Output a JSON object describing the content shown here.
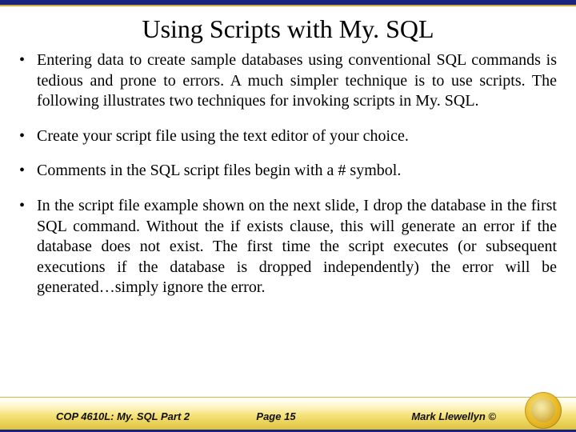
{
  "title": "Using Scripts with My. SQL",
  "bullets": [
    "Entering data to create sample databases using conventional SQL commands is tedious and prone to errors.  A much simpler technique is to use scripts.  The following illustrates two techniques for invoking scripts in My. SQL.",
    "Create your script file using the text editor of your choice.",
    "Comments in the SQL script files begin with a  # symbol.",
    "In the script file example shown on the next slide, I drop the database in the first SQL command.  Without the if exists clause, this will generate an error if the database does not exist.  The first time the script executes (or subsequent executions if the database is dropped independently) the error will be generated…simply ignore the error."
  ],
  "footer": {
    "left": "COP 4610L: My. SQL Part 2",
    "center": "Page 15",
    "right": "Mark Llewellyn ©"
  }
}
